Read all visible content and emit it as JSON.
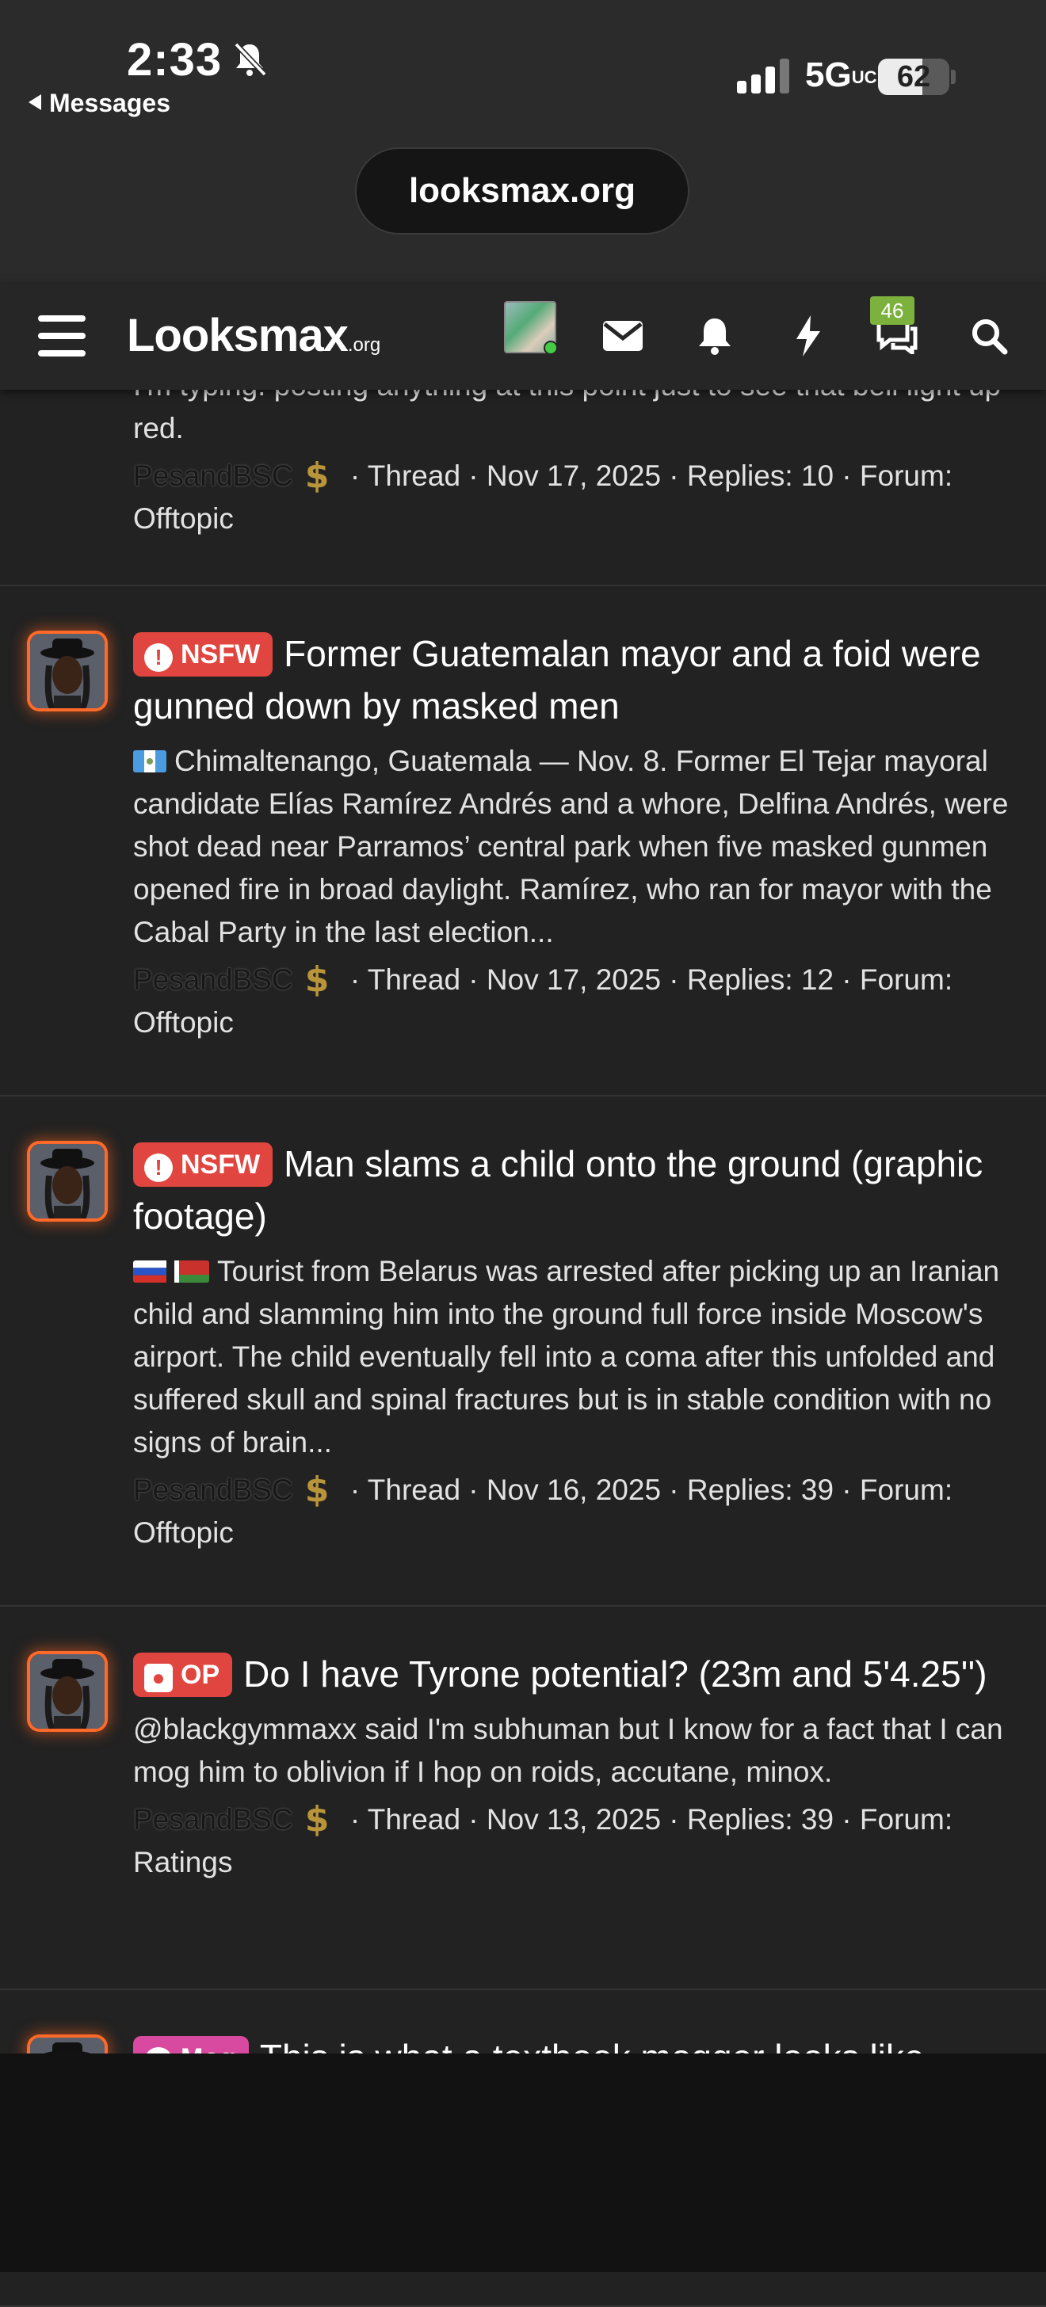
{
  "status_bar": {
    "time": "2:33",
    "back_label": "Messages",
    "network": "5G",
    "network_sup": "UC",
    "battery": "62",
    "battery_level": 0.62
  },
  "browser": {
    "url": "looksmax.org"
  },
  "header": {
    "logo_main": "Looksmax",
    "logo_suffix": ".org",
    "icons": [
      "menu-icon",
      "user-avatar",
      "mail-icon",
      "bell-icon",
      "bolt-icon",
      "chat-icon",
      "search-icon"
    ],
    "chat_badge": "46"
  },
  "colors": {
    "accent_red": "#e0463f",
    "accent_green": "#7bb13c",
    "accent_pink": "#d84aa0",
    "glow": "#ff6a2a"
  },
  "posts": [
    {
      "title": "",
      "snippet": "I'm typing. posting anything at this point just to see that bell light up red.",
      "username": "PesandBSC",
      "type": "Thread",
      "date": "Nov 17, 2025",
      "replies": "Replies: 10",
      "forum_label": "Forum:",
      "forum": "Offtopic"
    },
    {
      "label": "NSFW",
      "title": "Former Guatemalan mayor and a foid were gunned down by masked men",
      "snippet": "Chimaltenango, Guatemala — Nov. 8. Former El Tejar mayoral candidate Elías Ramírez Andrés and a whore, Delfina Andrés, were shot dead near Parramos’ central park when five masked gunmen opened fire in broad daylight. Ramírez, who ran for mayor with the Cabal Party in the last election...",
      "username": "PesandBSC",
      "type": "Thread",
      "date": "Nov 17, 2025",
      "replies": "Replies: 12",
      "forum_label": "Forum:",
      "forum": "Offtopic"
    },
    {
      "label": "NSFW",
      "title": "Man slams a child onto the ground (graphic footage)",
      "snippet": "Tourist from Belarus was arrested after picking up an Iranian child and slamming him into the ground full force inside Moscow's airport. The child eventually fell into a coma after this unfolded and suffered skull and spinal fractures but is in stable condition with no signs of brain...",
      "username": "PesandBSC",
      "type": "Thread",
      "date": "Nov 16, 2025",
      "replies": "Replies: 39",
      "forum_label": "Forum:",
      "forum": "Offtopic"
    },
    {
      "label": "OP",
      "title": "Do I have Tyrone potential? (23m and 5'4.25'')",
      "snippet": "@blackgymmaxx said I'm subhuman but I know for a fact that I can mog him to oblivion if I hop on roids, accutane, minox.",
      "username": "PesandBSC",
      "type": "Thread",
      "date": "Nov 13, 2025",
      "replies": "Replies: 39",
      "forum_label": "Forum:",
      "forum": "Ratings"
    },
    {
      "label": "Mog",
      "title": "This is what a textbook mogger looks like"
    }
  ]
}
